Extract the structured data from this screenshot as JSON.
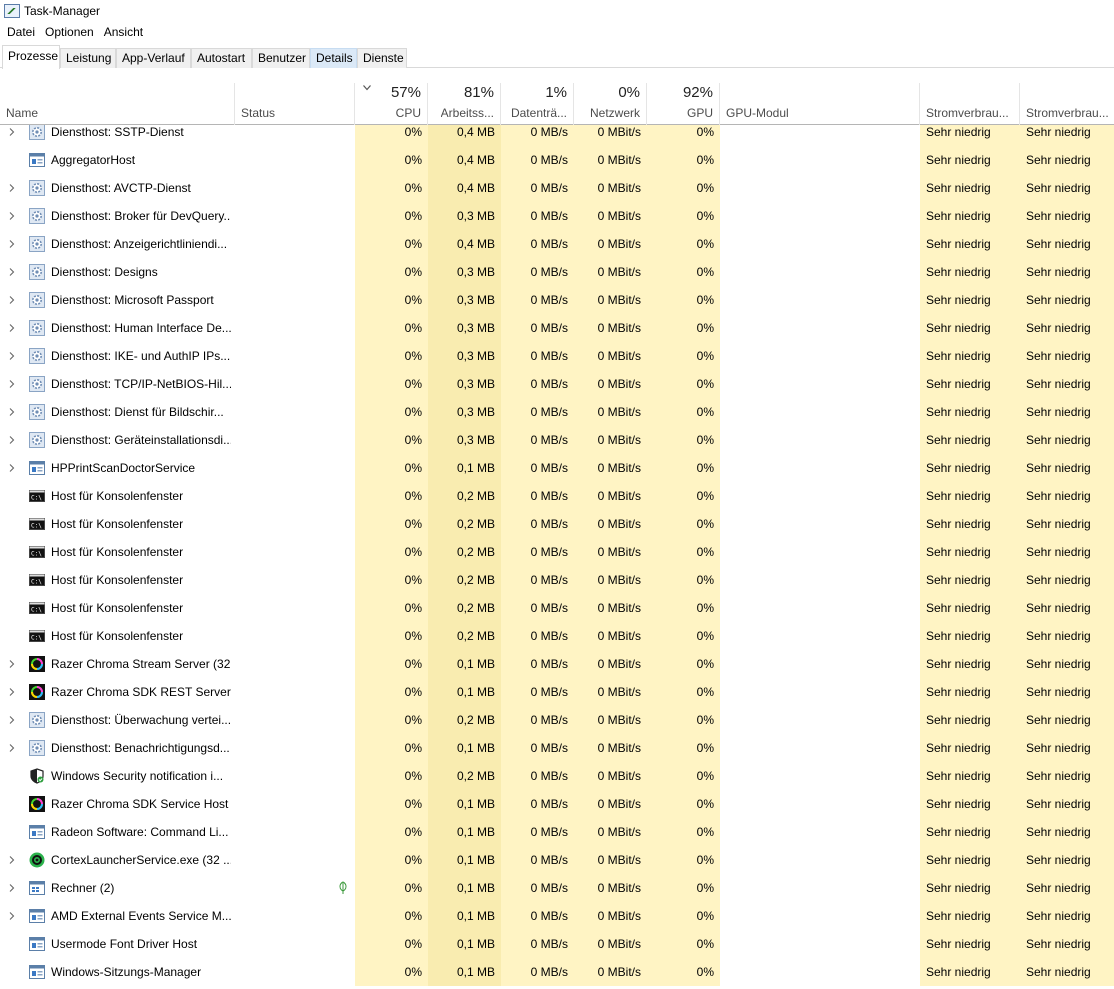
{
  "window": {
    "title": "Task-Manager"
  },
  "menu": [
    "Datei",
    "Optionen",
    "Ansicht"
  ],
  "tabs": [
    {
      "label": "Prozesse"
    },
    {
      "label": "Leistung"
    },
    {
      "label": "App-Verlauf"
    },
    {
      "label": "Autostart"
    },
    {
      "label": "Benutzer"
    },
    {
      "label": "Details"
    },
    {
      "label": "Dienste"
    }
  ],
  "columns": {
    "name": {
      "label": "Name"
    },
    "status": {
      "label": "Status"
    },
    "cpu": {
      "pct": "57%",
      "label": "CPU"
    },
    "mem": {
      "pct": "81%",
      "label": "Arbeitss..."
    },
    "disk": {
      "pct": "1%",
      "label": "Datenträ..."
    },
    "net": {
      "pct": "0%",
      "label": "Netzwerk"
    },
    "gpu": {
      "pct": "92%",
      "label": "GPU"
    },
    "gpumod": {
      "label": "GPU-Modul"
    },
    "power": {
      "label": "Stromverbrau..."
    },
    "power2": {
      "label": "Stromverbrau..."
    }
  },
  "colors": {
    "cpu_bg": "#fff4c4",
    "mem_bg": "#f9ecb0",
    "active_tab_highlight": "#dbe9f7"
  },
  "processes": [
    {
      "name": "Diensthost: SSTP-Dienst",
      "icon": "service-gear-icon",
      "expand": true,
      "cpu": "0%",
      "mem": "0,4 MB",
      "disk": "0 MB/s",
      "net": "0 MBit/s",
      "gpu": "0%",
      "power": "Sehr niedrig",
      "power2": "Sehr niedrig"
    },
    {
      "name": "AggregatorHost",
      "icon": "app-window-icon",
      "expand": false,
      "cpu": "0%",
      "mem": "0,4 MB",
      "disk": "0 MB/s",
      "net": "0 MBit/s",
      "gpu": "0%",
      "power": "Sehr niedrig",
      "power2": "Sehr niedrig"
    },
    {
      "name": "Diensthost: AVCTP-Dienst",
      "icon": "service-gear-icon",
      "expand": true,
      "cpu": "0%",
      "mem": "0,4 MB",
      "disk": "0 MB/s",
      "net": "0 MBit/s",
      "gpu": "0%",
      "power": "Sehr niedrig",
      "power2": "Sehr niedrig"
    },
    {
      "name": "Diensthost: Broker für DevQuery...",
      "icon": "service-gear-icon",
      "expand": true,
      "cpu": "0%",
      "mem": "0,3 MB",
      "disk": "0 MB/s",
      "net": "0 MBit/s",
      "gpu": "0%",
      "power": "Sehr niedrig",
      "power2": "Sehr niedrig"
    },
    {
      "name": "Diensthost: Anzeigerichtliniendi...",
      "icon": "service-gear-icon",
      "expand": true,
      "cpu": "0%",
      "mem": "0,4 MB",
      "disk": "0 MB/s",
      "net": "0 MBit/s",
      "gpu": "0%",
      "power": "Sehr niedrig",
      "power2": "Sehr niedrig"
    },
    {
      "name": "Diensthost: Designs",
      "icon": "service-gear-icon",
      "expand": true,
      "cpu": "0%",
      "mem": "0,3 MB",
      "disk": "0 MB/s",
      "net": "0 MBit/s",
      "gpu": "0%",
      "power": "Sehr niedrig",
      "power2": "Sehr niedrig"
    },
    {
      "name": "Diensthost: Microsoft Passport",
      "icon": "service-gear-icon",
      "expand": true,
      "cpu": "0%",
      "mem": "0,3 MB",
      "disk": "0 MB/s",
      "net": "0 MBit/s",
      "gpu": "0%",
      "power": "Sehr niedrig",
      "power2": "Sehr niedrig"
    },
    {
      "name": "Diensthost: Human Interface De...",
      "icon": "service-gear-icon",
      "expand": true,
      "cpu": "0%",
      "mem": "0,3 MB",
      "disk": "0 MB/s",
      "net": "0 MBit/s",
      "gpu": "0%",
      "power": "Sehr niedrig",
      "power2": "Sehr niedrig"
    },
    {
      "name": "Diensthost: IKE- und AuthIP IPs...",
      "icon": "service-gear-icon",
      "expand": true,
      "cpu": "0%",
      "mem": "0,3 MB",
      "disk": "0 MB/s",
      "net": "0 MBit/s",
      "gpu": "0%",
      "power": "Sehr niedrig",
      "power2": "Sehr niedrig"
    },
    {
      "name": "Diensthost: TCP/IP-NetBIOS-Hil...",
      "icon": "service-gear-icon",
      "expand": true,
      "cpu": "0%",
      "mem": "0,3 MB",
      "disk": "0 MB/s",
      "net": "0 MBit/s",
      "gpu": "0%",
      "power": "Sehr niedrig",
      "power2": "Sehr niedrig"
    },
    {
      "name": "Diensthost: Dienst für Bildschir...",
      "icon": "service-gear-icon",
      "expand": true,
      "cpu": "0%",
      "mem": "0,3 MB",
      "disk": "0 MB/s",
      "net": "0 MBit/s",
      "gpu": "0%",
      "power": "Sehr niedrig",
      "power2": "Sehr niedrig"
    },
    {
      "name": "Diensthost: Geräteinstallationsdi...",
      "icon": "service-gear-icon",
      "expand": true,
      "cpu": "0%",
      "mem": "0,3 MB",
      "disk": "0 MB/s",
      "net": "0 MBit/s",
      "gpu": "0%",
      "power": "Sehr niedrig",
      "power2": "Sehr niedrig"
    },
    {
      "name": "HPPrintScanDoctorService",
      "icon": "app-window-icon",
      "expand": true,
      "cpu": "0%",
      "mem": "0,1 MB",
      "disk": "0 MB/s",
      "net": "0 MBit/s",
      "gpu": "0%",
      "power": "Sehr niedrig",
      "power2": "Sehr niedrig"
    },
    {
      "name": "Host für Konsolenfenster",
      "icon": "console-icon",
      "expand": false,
      "cpu": "0%",
      "mem": "0,2 MB",
      "disk": "0 MB/s",
      "net": "0 MBit/s",
      "gpu": "0%",
      "power": "Sehr niedrig",
      "power2": "Sehr niedrig"
    },
    {
      "name": "Host für Konsolenfenster",
      "icon": "console-icon",
      "expand": false,
      "cpu": "0%",
      "mem": "0,2 MB",
      "disk": "0 MB/s",
      "net": "0 MBit/s",
      "gpu": "0%",
      "power": "Sehr niedrig",
      "power2": "Sehr niedrig"
    },
    {
      "name": "Host für Konsolenfenster",
      "icon": "console-icon",
      "expand": false,
      "cpu": "0%",
      "mem": "0,2 MB",
      "disk": "0 MB/s",
      "net": "0 MBit/s",
      "gpu": "0%",
      "power": "Sehr niedrig",
      "power2": "Sehr niedrig"
    },
    {
      "name": "Host für Konsolenfenster",
      "icon": "console-icon",
      "expand": false,
      "cpu": "0%",
      "mem": "0,2 MB",
      "disk": "0 MB/s",
      "net": "0 MBit/s",
      "gpu": "0%",
      "power": "Sehr niedrig",
      "power2": "Sehr niedrig"
    },
    {
      "name": "Host für Konsolenfenster",
      "icon": "console-icon",
      "expand": false,
      "cpu": "0%",
      "mem": "0,2 MB",
      "disk": "0 MB/s",
      "net": "0 MBit/s",
      "gpu": "0%",
      "power": "Sehr niedrig",
      "power2": "Sehr niedrig"
    },
    {
      "name": "Host für Konsolenfenster",
      "icon": "console-icon",
      "expand": false,
      "cpu": "0%",
      "mem": "0,2 MB",
      "disk": "0 MB/s",
      "net": "0 MBit/s",
      "gpu": "0%",
      "power": "Sehr niedrig",
      "power2": "Sehr niedrig"
    },
    {
      "name": "Razer Chroma Stream Server (32...",
      "icon": "razer-chroma-icon",
      "expand": true,
      "cpu": "0%",
      "mem": "0,1 MB",
      "disk": "0 MB/s",
      "net": "0 MBit/s",
      "gpu": "0%",
      "power": "Sehr niedrig",
      "power2": "Sehr niedrig"
    },
    {
      "name": "Razer Chroma SDK REST Server (...",
      "icon": "razer-chroma-icon",
      "expand": true,
      "cpu": "0%",
      "mem": "0,1 MB",
      "disk": "0 MB/s",
      "net": "0 MBit/s",
      "gpu": "0%",
      "power": "Sehr niedrig",
      "power2": "Sehr niedrig"
    },
    {
      "name": "Diensthost: Überwachung vertei...",
      "icon": "service-gear-icon",
      "expand": true,
      "cpu": "0%",
      "mem": "0,2 MB",
      "disk": "0 MB/s",
      "net": "0 MBit/s",
      "gpu": "0%",
      "power": "Sehr niedrig",
      "power2": "Sehr niedrig"
    },
    {
      "name": "Diensthost: Benachrichtigungsd...",
      "icon": "service-gear-icon",
      "expand": true,
      "cpu": "0%",
      "mem": "0,1 MB",
      "disk": "0 MB/s",
      "net": "0 MBit/s",
      "gpu": "0%",
      "power": "Sehr niedrig",
      "power2": "Sehr niedrig"
    },
    {
      "name": "Windows Security notification i...",
      "icon": "security-shield-icon",
      "expand": false,
      "cpu": "0%",
      "mem": "0,2 MB",
      "disk": "0 MB/s",
      "net": "0 MBit/s",
      "gpu": "0%",
      "power": "Sehr niedrig",
      "power2": "Sehr niedrig"
    },
    {
      "name": "Razer Chroma SDK Service Host ...",
      "icon": "razer-chroma-icon",
      "expand": false,
      "cpu": "0%",
      "mem": "0,1 MB",
      "disk": "0 MB/s",
      "net": "0 MBit/s",
      "gpu": "0%",
      "power": "Sehr niedrig",
      "power2": "Sehr niedrig"
    },
    {
      "name": "Radeon Software: Command Li...",
      "icon": "app-window-icon",
      "expand": false,
      "cpu": "0%",
      "mem": "0,1 MB",
      "disk": "0 MB/s",
      "net": "0 MBit/s",
      "gpu": "0%",
      "power": "Sehr niedrig",
      "power2": "Sehr niedrig"
    },
    {
      "name": "CortexLauncherService.exe (32 ...",
      "icon": "cortex-icon",
      "expand": true,
      "cpu": "0%",
      "mem": "0,1 MB",
      "disk": "0 MB/s",
      "net": "0 MBit/s",
      "gpu": "0%",
      "power": "Sehr niedrig",
      "power2": "Sehr niedrig"
    },
    {
      "name": "Rechner (2)",
      "icon": "calculator-icon",
      "expand": true,
      "suspended": true,
      "cpu": "0%",
      "mem": "0,1 MB",
      "disk": "0 MB/s",
      "net": "0 MBit/s",
      "gpu": "0%",
      "power": "Sehr niedrig",
      "power2": "Sehr niedrig"
    },
    {
      "name": "AMD External Events Service M...",
      "icon": "app-window-icon",
      "expand": true,
      "cpu": "0%",
      "mem": "0,1 MB",
      "disk": "0 MB/s",
      "net": "0 MBit/s",
      "gpu": "0%",
      "power": "Sehr niedrig",
      "power2": "Sehr niedrig"
    },
    {
      "name": "Usermode Font Driver Host",
      "icon": "app-window-icon",
      "expand": false,
      "cpu": "0%",
      "mem": "0,1 MB",
      "disk": "0 MB/s",
      "net": "0 MBit/s",
      "gpu": "0%",
      "power": "Sehr niedrig",
      "power2": "Sehr niedrig"
    },
    {
      "name": "Windows-Sitzungs-Manager",
      "icon": "app-window-icon",
      "expand": false,
      "cpu": "0%",
      "mem": "0,1 MB",
      "disk": "0 MB/s",
      "net": "0 MBit/s",
      "gpu": "0%",
      "power": "Sehr niedrig",
      "power2": "Sehr niedrig"
    }
  ]
}
